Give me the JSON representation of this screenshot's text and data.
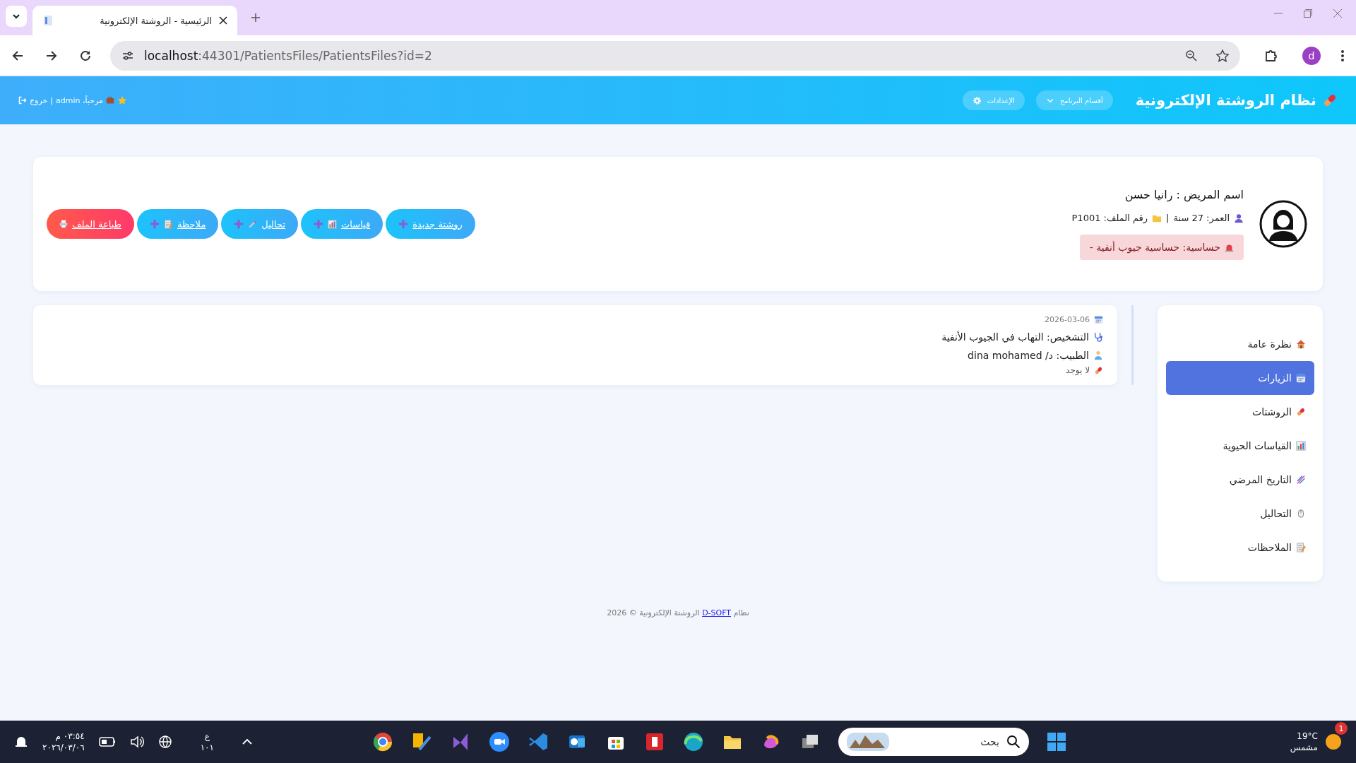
{
  "browser": {
    "tab_title": "الرئيسية - الروشتة الإلكترونية",
    "url_host": "localhost",
    "url_rest": ":44301/PatientsFiles/PatientsFiles?id=2",
    "profile_initial": "d"
  },
  "header": {
    "brand": "نظام الروشتة الإلكترونية",
    "menus": [
      {
        "label": "أقسام البرنامج",
        "kind": "dropdown"
      },
      {
        "label": "الإعدادات",
        "kind": "settings"
      }
    ],
    "greeting": "مرحباً، admin",
    "separator": "|",
    "logout": "خروج"
  },
  "patient": {
    "name_line": "اسم المريض : رانيا حسن",
    "age": "العمر: 27 سنة",
    "separator": "|",
    "file_no": "رقم الملف: P1001",
    "allergy": "حساسية: حساسية جيوب أنفية -"
  },
  "actions": [
    {
      "label": "روشتة جديدة",
      "kind": "new"
    },
    {
      "label": "قياسات",
      "kind": "measure"
    },
    {
      "label": "تحاليل",
      "kind": "lab"
    },
    {
      "label": "ملاحظة",
      "kind": "note"
    },
    {
      "label": "طباعة الملف",
      "kind": "print"
    }
  ],
  "visits": [
    {
      "date": "2026-03-06",
      "diagnosis": "التشخيص: التهاب في الجيوب الأنفية",
      "doctor": "الطبيب: د/ dina mohamed",
      "prescription": "لا يوجد"
    }
  ],
  "sidebar": {
    "items": [
      {
        "label": "نظرة عامة",
        "selected": false
      },
      {
        "label": "الزيارات",
        "selected": true
      },
      {
        "label": "الروشتات",
        "selected": false
      },
      {
        "label": "القياسات الحيوية",
        "selected": false
      },
      {
        "label": "التاريخ المرضي",
        "selected": false
      },
      {
        "label": "التحاليل",
        "selected": false
      },
      {
        "label": "الملاحظات",
        "selected": false
      }
    ]
  },
  "footer": {
    "before": "نظام",
    "link": "D-SOFT",
    "after": "الروشتة الإلكترونية © 2026"
  },
  "taskbar": {
    "time": "٠٣:٥٤ م",
    "date": "٢٠٢٦/٠٣/٠٦",
    "lang": "ع",
    "lang_sub": "١٠١",
    "search_placeholder": "بحث",
    "temperature": "19°C",
    "weather": "مشمس",
    "notification_count": "1"
  }
}
